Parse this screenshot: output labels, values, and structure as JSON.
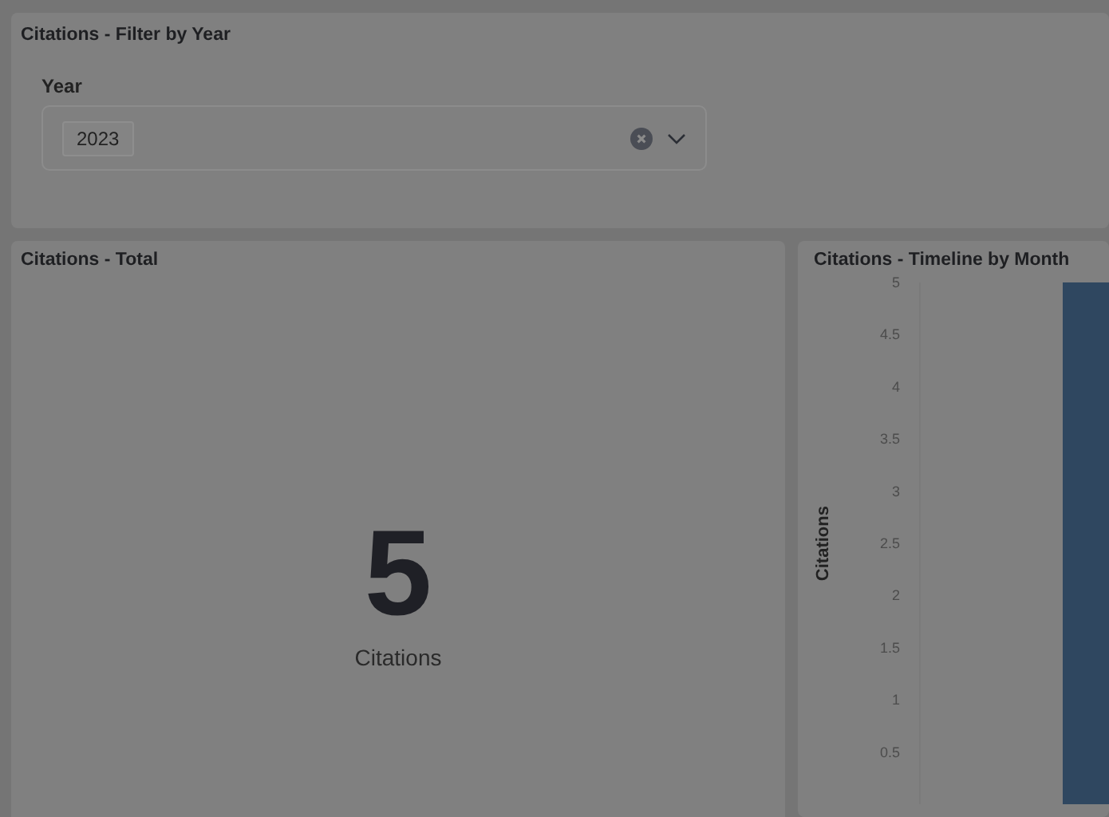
{
  "filter_panel": {
    "title": "Citations - Filter by Year",
    "field_label": "Year",
    "selected_tags": [
      "2023"
    ]
  },
  "total_panel": {
    "title": "Citations - Total",
    "value": "5",
    "caption": "Citations"
  },
  "timeline_panel": {
    "title": "Citations - Timeline by Month",
    "y_axis_label": "Citations",
    "y_axis_ticks": [
      "5",
      "4.5",
      "4",
      "3.5",
      "3",
      "2.5",
      "2",
      "1.5",
      "1",
      "0.5"
    ]
  }
}
